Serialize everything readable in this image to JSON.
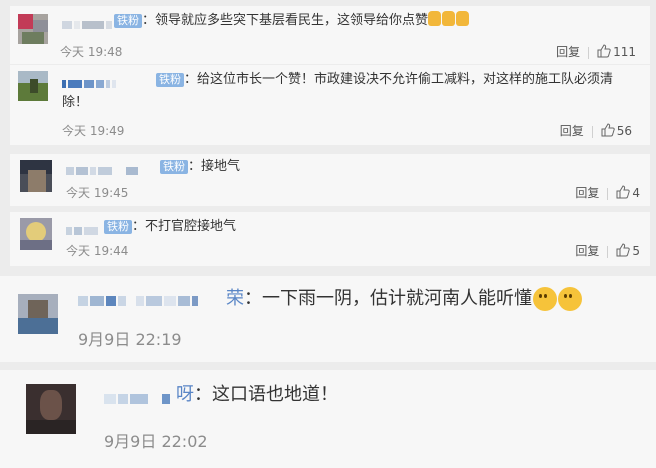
{
  "comments": [
    {
      "badge": "铁粉",
      "text": "：领导就应多些突下基层看民生，这领导给你点赞",
      "time": "今天 19:48",
      "reply_label": "回复",
      "likes": "111",
      "emoji": [
        "thumbs-up",
        "thumbs-up",
        "thumbs-up"
      ]
    },
    {
      "badge": "铁粉",
      "text_line1": "：给这位市长一个赞！市政建设决不允许偷工减料，对这样的施工队必须清",
      "text_line2": "除！",
      "time": "今天 19:49",
      "reply_label": "回复",
      "likes": "56"
    },
    {
      "badge": "铁粉",
      "text": "：接地气",
      "time": "今天 19:45",
      "reply_label": "回复",
      "likes": "4"
    },
    {
      "badge": "铁粉",
      "text": "：不打官腔接地气",
      "time": "今天 19:44",
      "reply_label": "回复",
      "likes": "5"
    },
    {
      "name_tail": "荣",
      "text": "：一下雨一阴，估计就河南人能听懂",
      "time": "9月9日 22:19",
      "emoji": [
        "thinking-face",
        "thinking-face"
      ]
    },
    {
      "name_tail": "呀",
      "text": "：这口语也地道！",
      "time": "9月9日 22:02"
    }
  ]
}
